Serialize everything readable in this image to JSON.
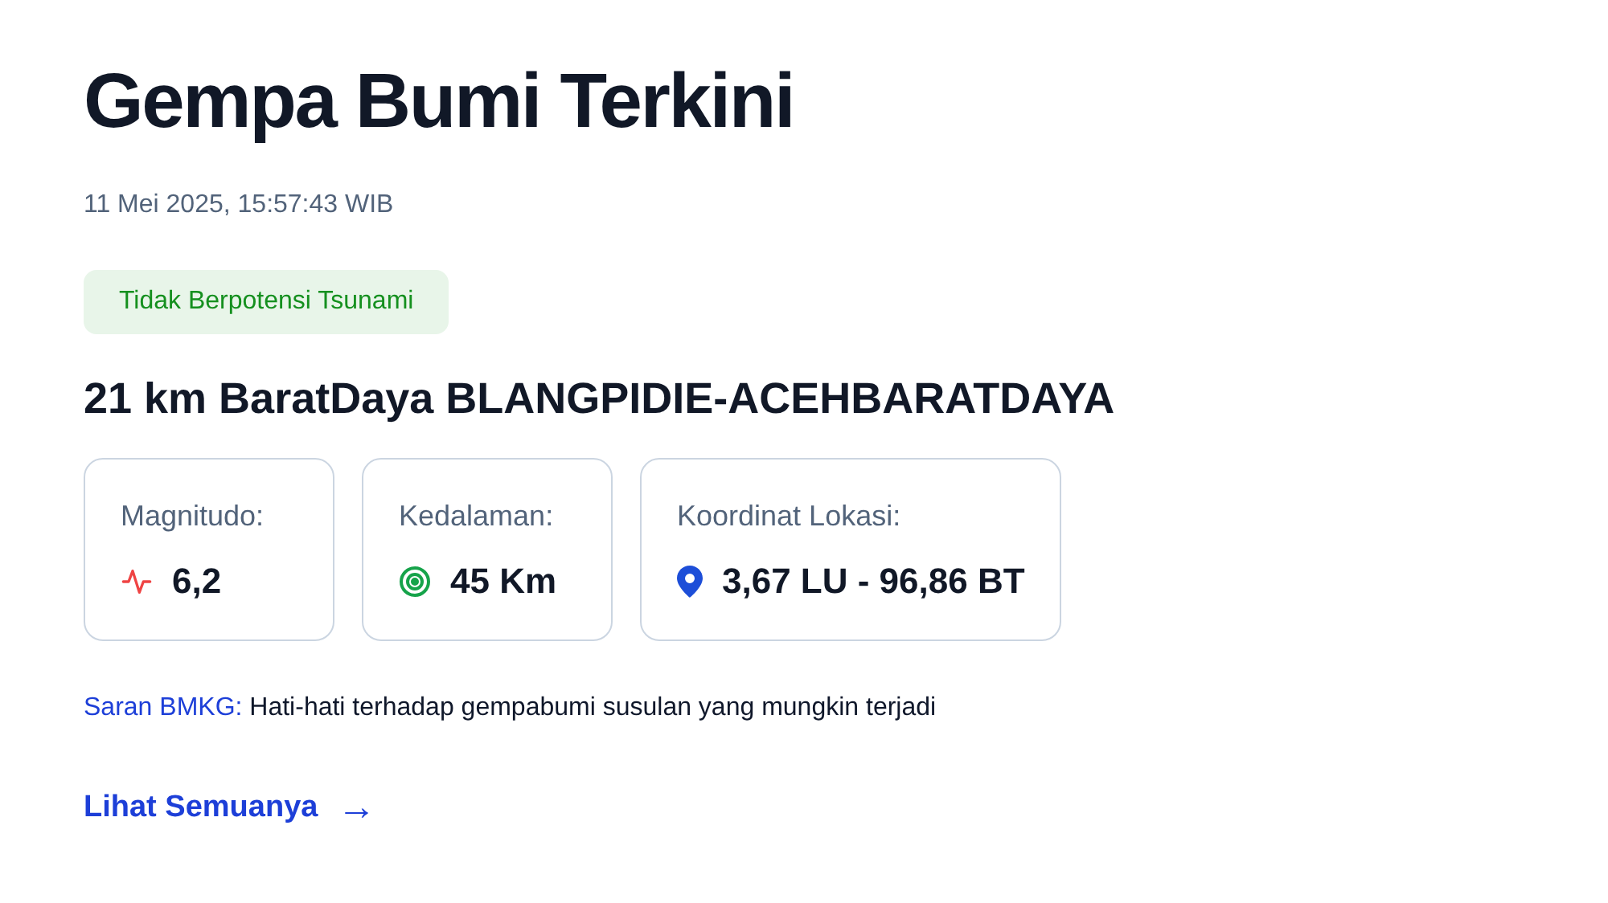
{
  "title": "Gempa Bumi Terkini",
  "datetime": "11 Mei 2025, 15:57:43 WIB",
  "badge": "Tidak Berpotensi Tsunami",
  "location": "21 km BaratDaya BLANGPIDIE-ACEHBARATDAYA",
  "stats": [
    {
      "kind": "magnitude",
      "label": "Magnitudo:",
      "value": "6,2"
    },
    {
      "kind": "depth",
      "label": "Kedalaman:",
      "value": "45 Km"
    },
    {
      "kind": "coordinates",
      "label": "Koordinat Lokasi:",
      "value": "3,67 LU - 96,86 BT"
    }
  ],
  "advice": {
    "label": "Saran BMKG:",
    "text": "Hati-hati terhadap gempabumi susulan yang mungkin terjadi"
  },
  "link": {
    "label": "Lihat Semuanya",
    "arrow": "→"
  }
}
